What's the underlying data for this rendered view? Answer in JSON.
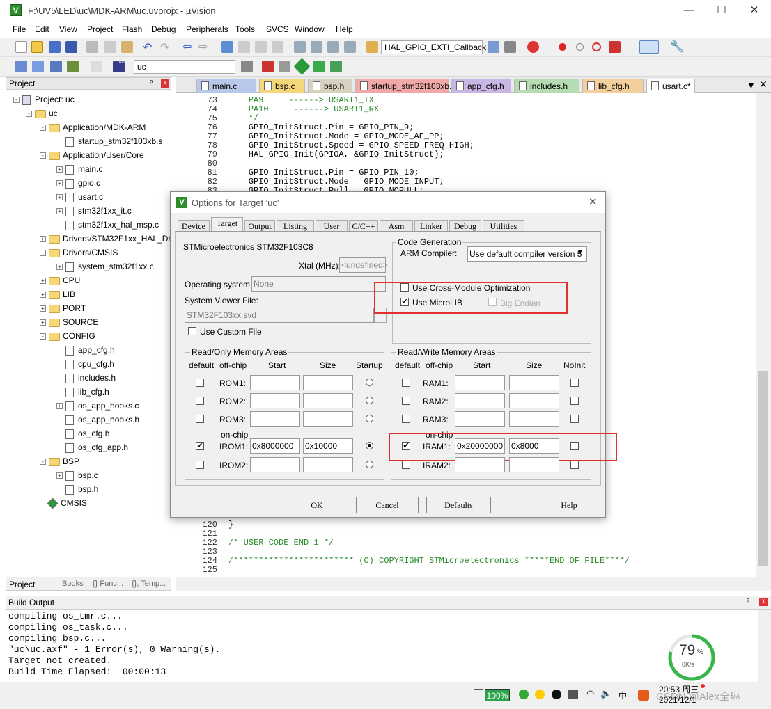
{
  "window": {
    "title": "F:\\UV5\\LED\\uc\\MDK-ARM\\uc.uvprojx - µVision",
    "min": "—",
    "max": "☐",
    "close": "✕"
  },
  "menu": [
    "File",
    "Edit",
    "View",
    "Project",
    "Flash",
    "Debug",
    "Peripherals",
    "Tools",
    "SVCS",
    "Window",
    "Help"
  ],
  "toolbar": {
    "function_combo": "HAL_GPIO_EXTI_Callback",
    "target_combo": "uc"
  },
  "project": {
    "header": "Project",
    "pin": "ᵖ",
    "close": "x",
    "tree": [
      {
        "label": "Project: uc",
        "type": "root"
      },
      {
        "label": "uc",
        "type": "target"
      },
      {
        "label": "Application/MDK-ARM",
        "type": "folder"
      },
      {
        "label": "startup_stm32f103xb.s",
        "type": "file"
      },
      {
        "label": "Application/User/Core",
        "type": "folder"
      },
      {
        "label": "main.c",
        "type": "file"
      },
      {
        "label": "gpio.c",
        "type": "file"
      },
      {
        "label": "usart.c",
        "type": "file"
      },
      {
        "label": "stm32f1xx_it.c",
        "type": "file"
      },
      {
        "label": "stm32f1xx_hal_msp.c",
        "type": "file"
      },
      {
        "label": "Drivers/STM32F1xx_HAL_Driv",
        "type": "folder"
      },
      {
        "label": "Drivers/CMSIS",
        "type": "folder"
      },
      {
        "label": "system_stm32f1xx.c",
        "type": "file"
      },
      {
        "label": "CPU",
        "type": "folder"
      },
      {
        "label": "LIB",
        "type": "folder"
      },
      {
        "label": "PORT",
        "type": "folder"
      },
      {
        "label": "SOURCE",
        "type": "folder"
      },
      {
        "label": "CONFIG",
        "type": "folder"
      },
      {
        "label": "app_cfg.h",
        "type": "file"
      },
      {
        "label": "cpu_cfg.h",
        "type": "file"
      },
      {
        "label": "includes.h",
        "type": "file"
      },
      {
        "label": "lib_cfg.h",
        "type": "file"
      },
      {
        "label": "os_app_hooks.c",
        "type": "file"
      },
      {
        "label": "os_app_hooks.h",
        "type": "file"
      },
      {
        "label": "os_cfg.h",
        "type": "file"
      },
      {
        "label": "os_cfg_app.h",
        "type": "file"
      },
      {
        "label": "BSP",
        "type": "folder"
      },
      {
        "label": "bsp.c",
        "type": "file"
      },
      {
        "label": "bsp.h",
        "type": "file"
      },
      {
        "label": "CMSIS",
        "type": "component"
      }
    ],
    "bottom_tabs": [
      "Project",
      "Books",
      "{} Func...",
      "{}, Temp..."
    ]
  },
  "editor": {
    "tabs": [
      {
        "label": "main.c",
        "color": "#b9c7ea"
      },
      {
        "label": "bsp.c",
        "color": "#f5d67a"
      },
      {
        "label": "bsp.h",
        "color": "#d7d1c0"
      },
      {
        "label": "startup_stm32f103xb.s",
        "color": "#f0a8a8"
      },
      {
        "label": "app_cfg.h",
        "color": "#c9b6e6"
      },
      {
        "label": "includes.h",
        "color": "#b6dcb2"
      },
      {
        "label": "lib_cfg.h",
        "color": "#f3cf9e"
      },
      {
        "label": "usart.c*",
        "color": "#ffffff"
      }
    ],
    "lines_top": [
      {
        "n": "73",
        "code": "    PA9     ------> USART1_TX",
        "color": "#2a8a2a"
      },
      {
        "n": "74",
        "code": "    PA10     ------> USART1_RX",
        "color": "#2a8a2a"
      },
      {
        "n": "75",
        "code": "    */",
        "color": "#2a8a2a"
      },
      {
        "n": "76",
        "code": "    GPIO_InitStruct.Pin = GPIO_PIN_9;",
        "color": "#000"
      },
      {
        "n": "77",
        "code": "    GPIO_InitStruct.Mode = GPIO_MODE_AF_PP;",
        "color": "#000"
      },
      {
        "n": "78",
        "code": "    GPIO_InitStruct.Speed = GPIO_SPEED_FREQ_HIGH;",
        "color": "#000"
      },
      {
        "n": "79",
        "code": "    HAL_GPIO_Init(GPIOA, &GPIO_InitStruct);",
        "color": "#000"
      },
      {
        "n": "80",
        "code": "",
        "color": "#000"
      },
      {
        "n": "81",
        "code": "    GPIO_InitStruct.Pin = GPIO_PIN_10;",
        "color": "#000"
      },
      {
        "n": "82",
        "code": "    GPIO_InitStruct.Mode = GPIO_MODE_INPUT;",
        "color": "#000"
      },
      {
        "n": "83",
        "code": "    GPIO_InitStruct.Pull = GPIO_NOPULL;",
        "color": "#000"
      }
    ],
    "lines_bottom": [
      {
        "n": "120",
        "code": "}",
        "color": "#000"
      },
      {
        "n": "121",
        "code": "",
        "color": "#000"
      },
      {
        "n": "122",
        "code": "/* USER CODE END 1 */",
        "color": "#2a8a2a"
      },
      {
        "n": "123",
        "code": "",
        "color": "#000"
      },
      {
        "n": "124",
        "code": "/************************ (C) COPYRIGHT STMicroelectronics *****END OF FILE****/",
        "color": "#2a8a2a"
      },
      {
        "n": "125",
        "code": "",
        "color": "#000"
      }
    ]
  },
  "dialog": {
    "title": "Options for Target 'uc'",
    "tabs": [
      "Device",
      "Target",
      "Output",
      "Listing",
      "User",
      "C/C++",
      "Asm",
      "Linker",
      "Debug",
      "Utilities"
    ],
    "active_tab": "Target",
    "device": "STMicroelectronics STM32F103C8",
    "xtal_label": "Xtal (MHz):",
    "xtal_value": "<undefined>",
    "os_label": "Operating system:",
    "os_value": "None",
    "svf_label": "System Viewer File:",
    "svf_value": "STM32F103xx.svd",
    "use_custom_file": "Use Custom File",
    "codegen": {
      "title": "Code Generation",
      "compiler_label": "ARM Compiler:",
      "compiler_value": "Use default compiler version 5",
      "cross_module": "Use Cross-Module Optimization",
      "microlib": "Use MicroLIB",
      "big_endian": "Big Endian"
    },
    "rom": {
      "title": "Read/Only Memory Areas",
      "headers": [
        "default",
        "off-chip",
        "Start",
        "Size",
        "Startup"
      ],
      "onchip": "on-chip",
      "rows": [
        {
          "name": "ROM1:",
          "start": "",
          "size": "",
          "default": false,
          "startup": false
        },
        {
          "name": "ROM2:",
          "start": "",
          "size": "",
          "default": false,
          "startup": false
        },
        {
          "name": "ROM3:",
          "start": "",
          "size": "",
          "default": false,
          "startup": false
        },
        {
          "name": "IROM1:",
          "start": "0x8000000",
          "size": "0x10000",
          "default": true,
          "startup": true
        },
        {
          "name": "IROM2:",
          "start": "",
          "size": "",
          "default": false,
          "startup": false
        }
      ]
    },
    "ram": {
      "title": "Read/Write Memory Areas",
      "headers": [
        "default",
        "off-chip",
        "Start",
        "Size",
        "NoInit"
      ],
      "onchip": "on-chip",
      "rows": [
        {
          "name": "RAM1:",
          "start": "",
          "size": "",
          "default": false
        },
        {
          "name": "RAM2:",
          "start": "",
          "size": "",
          "default": false
        },
        {
          "name": "RAM3:",
          "start": "",
          "size": "",
          "default": false
        },
        {
          "name": "IRAM1:",
          "start": "0x20000000",
          "size": "0x8000",
          "default": true
        },
        {
          "name": "IRAM2:",
          "start": "",
          "size": "",
          "default": false
        }
      ]
    },
    "buttons": {
      "ok": "OK",
      "cancel": "Cancel",
      "defaults": "Defaults",
      "help": "Help"
    }
  },
  "build_output": {
    "header": "Build Output",
    "lines": [
      "compiling os_tmr.c...",
      "compiling os_task.c...",
      "compiling bsp.c...",
      "\"uc\\uc.axf\" - 1 Error(s), 0 Warning(s).",
      "Target not created.",
      "Build Time Elapsed:  00:00:13"
    ]
  },
  "widget": {
    "percent": "79",
    "percent_sign": "%",
    "rate": "0K/s",
    "level": 0.79
  },
  "tray": {
    "battery": "100%",
    "time": "20:53 周三",
    "date": "2021/12/1",
    "ime": "中",
    "watermark": "CSDN @Alex全琳"
  }
}
